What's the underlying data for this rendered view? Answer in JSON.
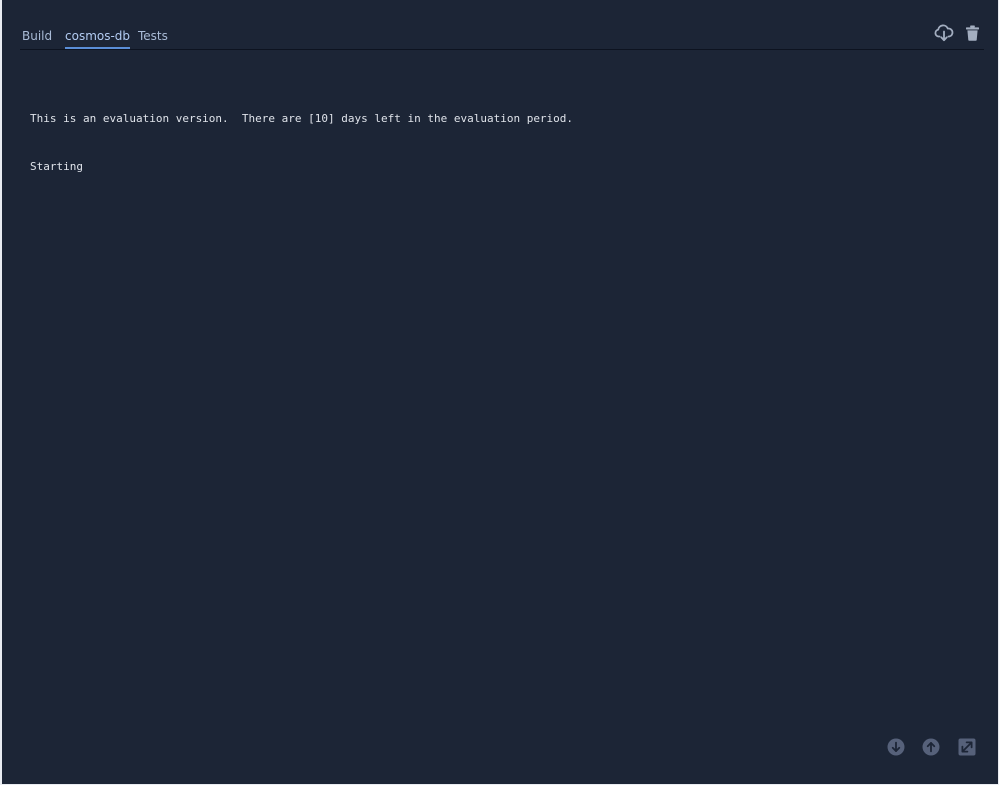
{
  "tabs": [
    {
      "label": "Build",
      "active": false
    },
    {
      "label": "cosmos-db",
      "active": true
    },
    {
      "label": "Tests",
      "active": false
    }
  ],
  "toolbar": {
    "icons": [
      "cloud-download-icon",
      "trash-icon"
    ]
  },
  "console": {
    "lines": [
      "This is an evaluation version.  There are [10] days left in the evaluation period.",
      "Starting"
    ]
  },
  "footer_icons": [
    "scroll-to-bottom-icon",
    "scroll-to-top-icon",
    "expand-icon"
  ],
  "colors": {
    "background": "#1c2536",
    "tab_text": "#a9bbd6",
    "tab_active_text": "#b3ccf2",
    "tab_active_underline": "#5a8ed8",
    "console_text": "#dfe3ea",
    "icon": "#a3aec0",
    "footer_icon": "#56617a"
  }
}
